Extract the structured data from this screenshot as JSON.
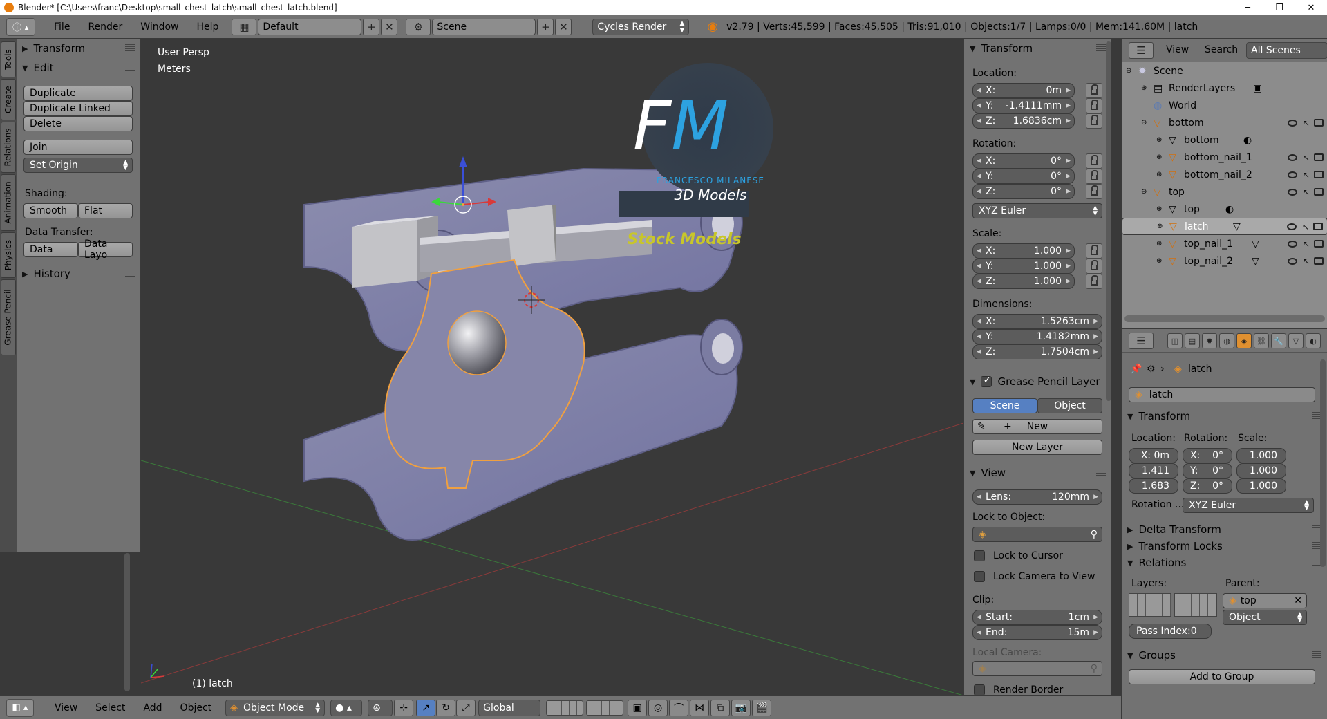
{
  "window": {
    "title": "Blender* [C:\\Users\\franc\\Desktop\\small_chest_latch\\small_chest_latch.blend]"
  },
  "infobar": {
    "menus": [
      "File",
      "Render",
      "Window",
      "Help"
    ],
    "layout": "Default",
    "scene": "Scene",
    "engine": "Cycles Render",
    "stats": "v2.79 | Verts:45,599 | Faces:45,505 | Tris:91,010 | Objects:1/7 | Lamps:0/0 | Mem:141.60M | latch"
  },
  "left_tabs": [
    "Tools",
    "Create",
    "Relations",
    "Animation",
    "Physics",
    "Grease Pencil"
  ],
  "toolshelf": {
    "transform_header": "Transform",
    "edit_header": "Edit",
    "duplicate": "Duplicate",
    "duplicate_linked": "Duplicate Linked",
    "delete": "Delete",
    "join": "Join",
    "set_origin": "Set Origin",
    "shading_label": "Shading:",
    "smooth": "Smooth",
    "flat": "Flat",
    "data_transfer_label": "Data Transfer:",
    "data": "Data",
    "data_layout": "Data Layo",
    "history_header": "History"
  },
  "viewport": {
    "view_name": "User Persp",
    "units": "Meters",
    "object_label": "(1) latch",
    "watermark_initials": "FM",
    "watermark_name": "FRANCESCO MILANESE",
    "watermark_sub": "3D Models",
    "watermark_stock": "Stock Models"
  },
  "npanel": {
    "transform_header": "Transform",
    "location_label": "Location:",
    "loc_x": "0m",
    "loc_y": "-1.4111mm",
    "loc_z": "1.6836cm",
    "rotation_label": "Rotation:",
    "rot_x": "0°",
    "rot_y": "0°",
    "rot_z": "0°",
    "rotation_mode": "XYZ Euler",
    "scale_label": "Scale:",
    "scale_x": "1.000",
    "scale_y": "1.000",
    "scale_z": "1.000",
    "dimensions_label": "Dimensions:",
    "dim_x": "1.5263cm",
    "dim_y": "1.4182mm",
    "dim_z": "1.7504cm",
    "gp_header": "Grease Pencil Layer",
    "gp_scene": "Scene",
    "gp_object": "Object",
    "gp_new": "New",
    "gp_new_layer": "New Layer",
    "view_header": "View",
    "lens_label": "Lens:",
    "lens_value": "120mm",
    "lock_object_label": "Lock to Object:",
    "lock_cursor": "Lock to Cursor",
    "lock_camera": "Lock Camera to View",
    "clip_label": "Clip:",
    "clip_start_label": "Start:",
    "clip_start": "1cm",
    "clip_end_label": "End:",
    "clip_end": "15m",
    "local_camera_label": "Local Camera:",
    "render_border": "Render Border",
    "axis_x": "X:",
    "axis_y": "Y:",
    "axis_z": "Z:"
  },
  "outliner": {
    "view": "View",
    "search": "Search",
    "all_scenes": "All Scenes",
    "items": [
      {
        "label": "Scene",
        "depth": 0,
        "icon": "scene-icon"
      },
      {
        "label": "RenderLayers",
        "depth": 1,
        "icon": "renderlayers-icon"
      },
      {
        "label": "World",
        "depth": 1,
        "icon": "world-icon"
      },
      {
        "label": "bottom",
        "depth": 1,
        "icon": "empty-icon"
      },
      {
        "label": "bottom",
        "depth": 2,
        "icon": "mesh-icon"
      },
      {
        "label": "bottom_nail_1",
        "depth": 2,
        "icon": "empty-icon"
      },
      {
        "label": "bottom_nail_2",
        "depth": 2,
        "icon": "empty-icon"
      },
      {
        "label": "top",
        "depth": 1,
        "icon": "empty-icon"
      },
      {
        "label": "top",
        "depth": 2,
        "icon": "mesh-icon"
      },
      {
        "label": "latch",
        "depth": 2,
        "icon": "empty-icon"
      },
      {
        "label": "top_nail_1",
        "depth": 2,
        "icon": "empty-icon"
      },
      {
        "label": "top_nail_2",
        "depth": 2,
        "icon": "empty-icon"
      }
    ]
  },
  "properties": {
    "breadcrumb": "latch",
    "object_name": "latch",
    "transform_header": "Transform",
    "location_label": "Location:",
    "rotation_label": "Rotation:",
    "scale_label": "Scale:",
    "loc_x": "X: 0m",
    "loc_y": "1.411",
    "loc_z": "1.683",
    "rot_x": "X:",
    "rot_x_val": "0°",
    "rot_y": "Y:",
    "rot_y_val": "0°",
    "rot_z": "Z:",
    "rot_z_val": "0°",
    "scale_x": "1.000",
    "scale_y": "1.000",
    "scale_z": "1.000",
    "rotation_mode_label": "Rotation ...",
    "rotation_mode": "XYZ Euler",
    "delta_transform": "Delta Transform",
    "transform_locks": "Transform Locks",
    "relations": "Relations",
    "layers_label": "Layers:",
    "parent_label": "Parent:",
    "parent_value": "top",
    "parent_type": "Object",
    "pass_index": "Pass Index:0",
    "groups": "Groups",
    "add_to_group": "Add to Group"
  },
  "bottombar": {
    "view": "View",
    "select": "Select",
    "add": "Add",
    "object": "Object",
    "mode": "Object Mode",
    "orientation": "Global"
  }
}
